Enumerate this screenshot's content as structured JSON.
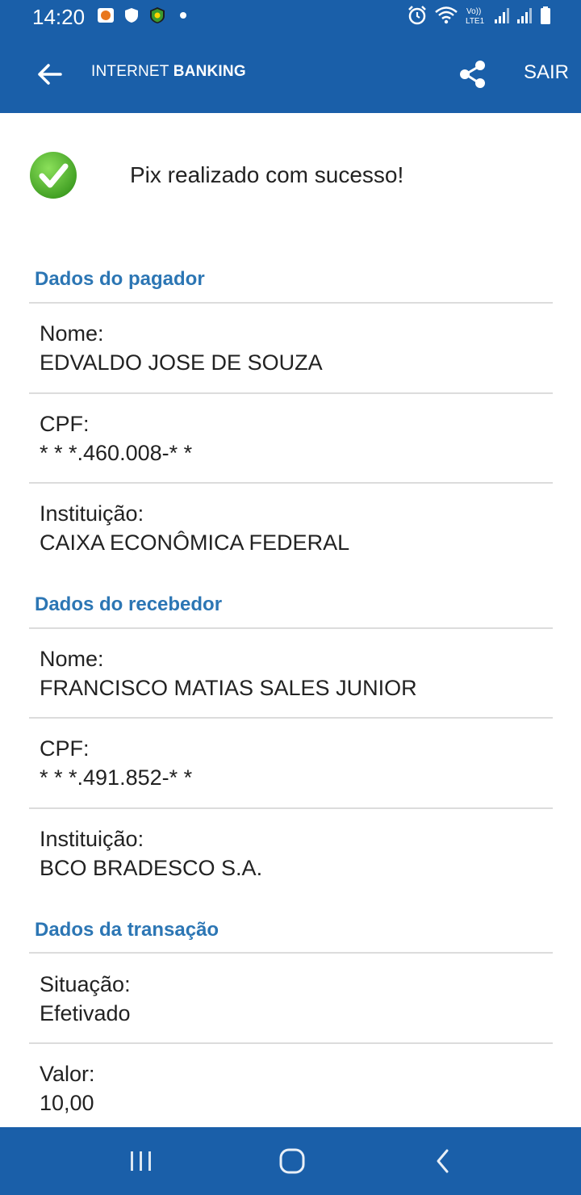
{
  "status_bar": {
    "time": "14:20",
    "left_icons": [
      "notification-app-icon",
      "shield-icon",
      "sports-badge-icon",
      "dot-icon"
    ],
    "right_icons": [
      "alarm-icon",
      "wifi-icon",
      "volte-lte-icon",
      "signal-icon",
      "signal-icon",
      "battery-icon"
    ]
  },
  "header": {
    "title_light": "INTERNET ",
    "title_bold": "BANKING",
    "logout_label": "SAIR",
    "back_icon": "arrow-left-icon",
    "share_icon": "share-icon"
  },
  "success": {
    "message": "Pix realizado com sucesso!"
  },
  "payer": {
    "title": "Dados do pagador",
    "name_label": "Nome:",
    "name_value": "EDVALDO JOSE DE SOUZA",
    "cpf_label": "CPF:",
    "cpf_value": "* * *.460.008-* *",
    "institution_label": "Instituição:",
    "institution_value": "CAIXA ECONÔMICA FEDERAL"
  },
  "receiver": {
    "title": "Dados do recebedor",
    "name_label": "Nome:",
    "name_value": "FRANCISCO MATIAS SALES JUNIOR",
    "cpf_label": "CPF:",
    "cpf_value": "* * *.491.852-* *",
    "institution_label": "Instituição:",
    "institution_value": "BCO BRADESCO S.A."
  },
  "transaction": {
    "title": "Dados da transação",
    "status_label": "Situação:",
    "status_value": "Efetivado",
    "amount_label": "Valor:",
    "amount_value": "10,00"
  },
  "colors": {
    "brand_blue": "#1a5fa9",
    "section_title": "#2c76b4",
    "success_green": "#4caf2a"
  },
  "nav_bar": {
    "icons": [
      "recent-apps-icon",
      "home-icon",
      "back-chevron-icon"
    ]
  }
}
